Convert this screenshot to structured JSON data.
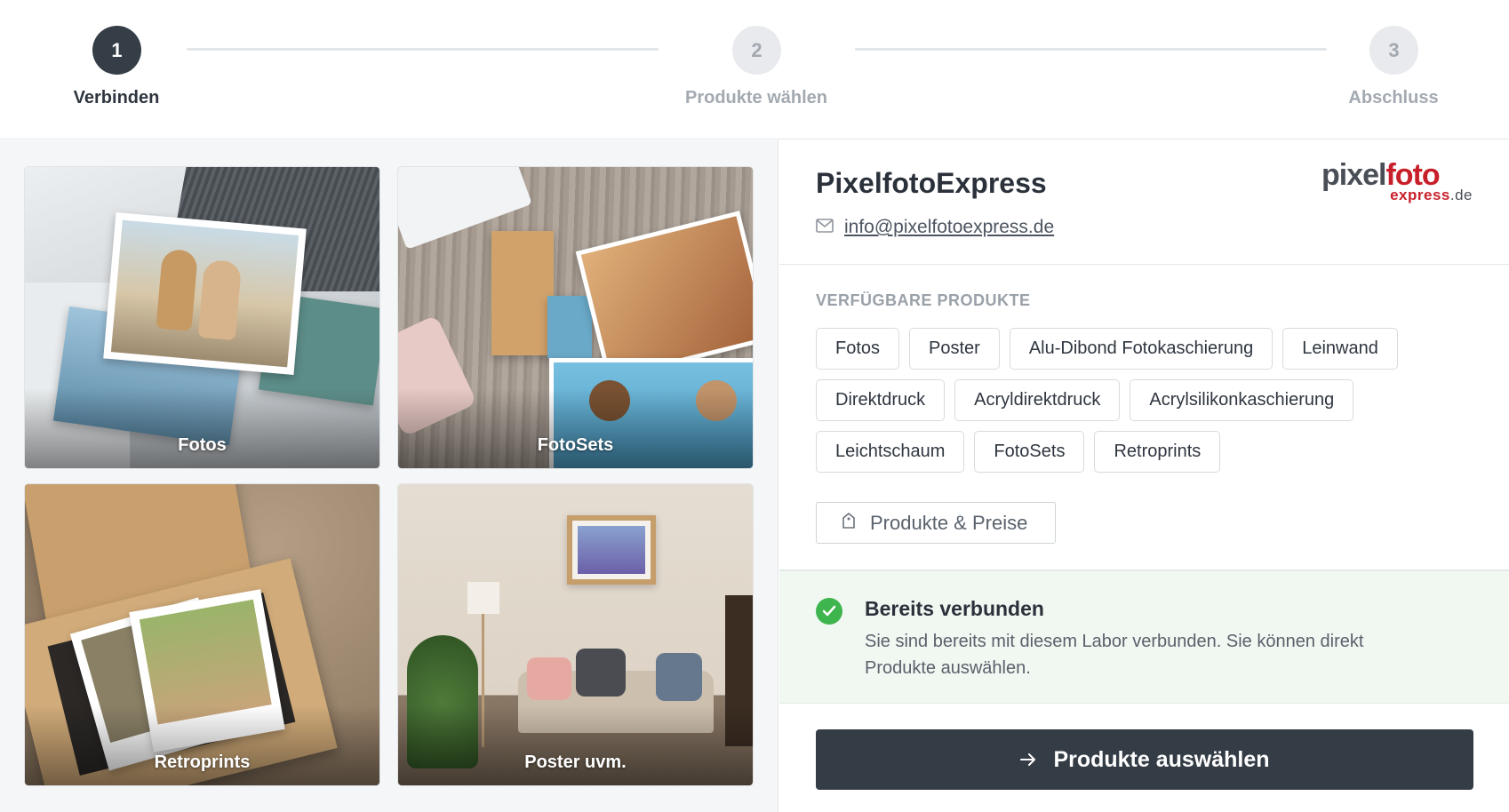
{
  "stepper": {
    "steps": [
      {
        "number": "1",
        "label": "Verbinden",
        "state": "active"
      },
      {
        "number": "2",
        "label": "Produkte wählen",
        "state": "inactive"
      },
      {
        "number": "3",
        "label": "Abschluss",
        "state": "inactive"
      }
    ]
  },
  "gallery": {
    "tiles": [
      {
        "label": "Fotos"
      },
      {
        "label": "FotoSets"
      },
      {
        "label": "Retroprints"
      },
      {
        "label": "Poster uvm."
      }
    ]
  },
  "lab": {
    "name": "PixelfotoExpress",
    "email": "info@pixelfotoexpress.de",
    "logo": {
      "part1": "pixel",
      "part2": "foto",
      "part3": "express",
      "part4": ".de"
    }
  },
  "products": {
    "title": "VERFÜGBARE PRODUKTE",
    "rows": [
      [
        "Fotos",
        "Poster",
        "Alu-Dibond Fotokaschierung",
        "Leinwand"
      ],
      [
        "Direktdruck",
        "Acryldirektdruck",
        "Acrylsilikonkaschierung"
      ],
      [
        "Leichtschaum",
        "FotoSets",
        "Retroprints"
      ]
    ],
    "prices_button": "Produkte & Preise"
  },
  "notice": {
    "title": "Bereits verbunden",
    "text": "Sie sind bereits mit diesem Labor verbunden. Sie können direkt Produkte auswählen."
  },
  "actions": {
    "primary_label": "Produkte auswählen"
  },
  "colors": {
    "primary": "#343c46",
    "success": "#3fb54e",
    "logo_red": "#c8202a"
  }
}
